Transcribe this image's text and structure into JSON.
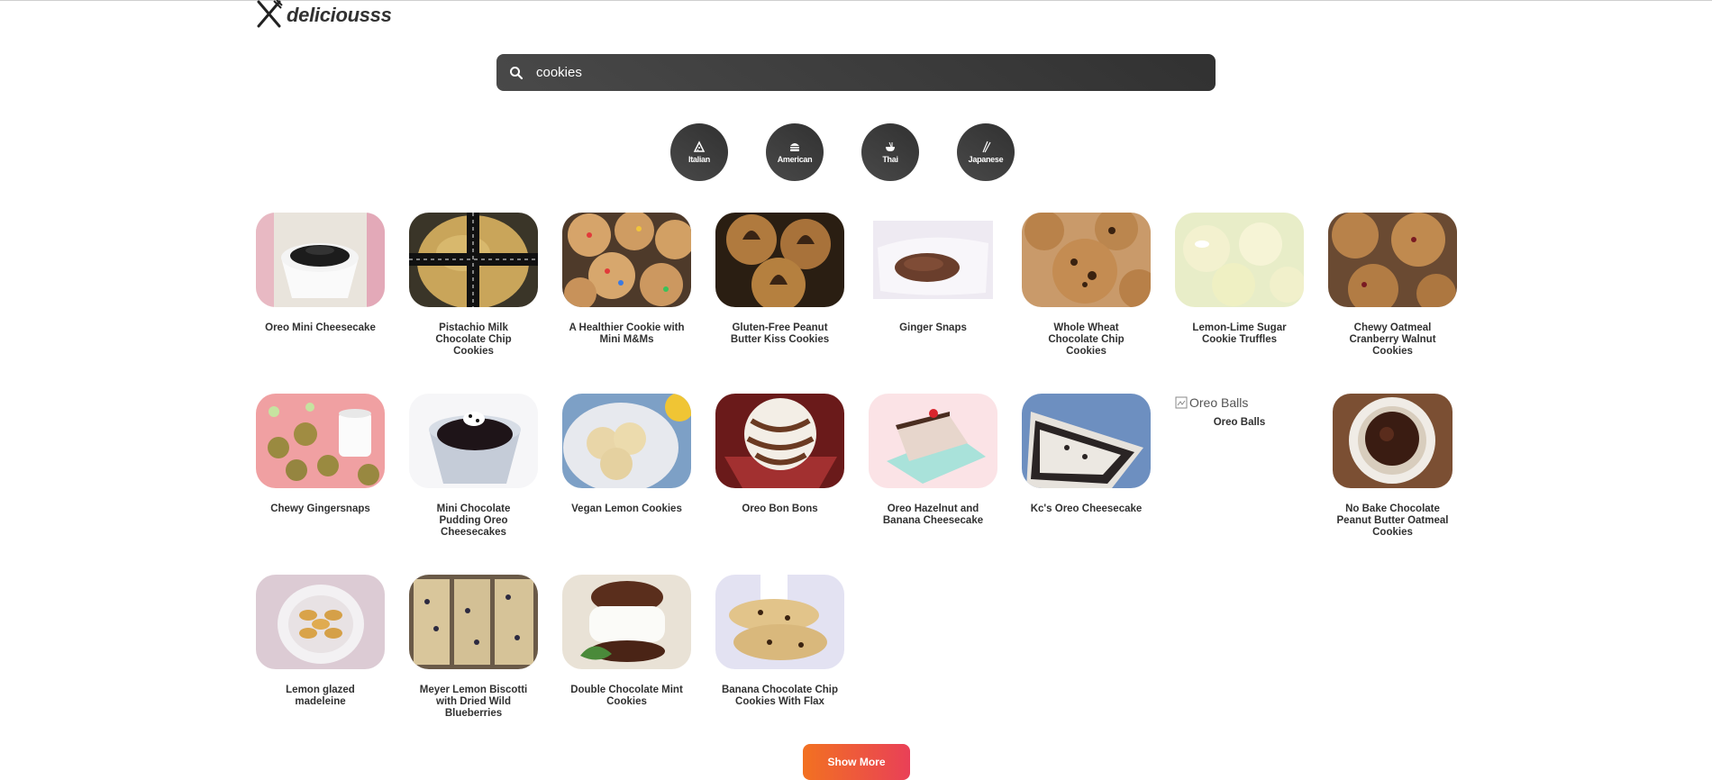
{
  "brand": {
    "name": "deliciousss",
    "icon": "fork-knife-icon"
  },
  "search": {
    "value": "cookies",
    "icon": "search-icon"
  },
  "cuisines": [
    {
      "label": "Italian",
      "icon": "pizza-icon"
    },
    {
      "label": "American",
      "icon": "hamburger-icon"
    },
    {
      "label": "Thai",
      "icon": "noodle-bowl-icon"
    },
    {
      "label": "Japanese",
      "icon": "chopsticks-icon"
    }
  ],
  "recipes": [
    {
      "title": "Oreo Mini Cheesecake"
    },
    {
      "title": "Pistachio Milk Chocolate Chip Cookies"
    },
    {
      "title": "A Healthier Cookie with Mini M&Ms"
    },
    {
      "title": "Gluten-Free Peanut Butter Kiss Cookies"
    },
    {
      "title": "Ginger Snaps"
    },
    {
      "title": "Whole Wheat Chocolate Chip Cookies"
    },
    {
      "title": "Lemon-Lime Sugar Cookie Truffles"
    },
    {
      "title": "Chewy Oatmeal Cranberry Walnut Cookies"
    },
    {
      "title": "Chewy Gingersnaps"
    },
    {
      "title": "Mini Chocolate Pudding Oreo Cheesecakes"
    },
    {
      "title": "Vegan Lemon Cookies"
    },
    {
      "title": "Oreo Bon Bons"
    },
    {
      "title": "Oreo Hazelnut and Banana Cheesecake"
    },
    {
      "title": "Kc's Oreo Cheesecake"
    },
    {
      "title": "Oreo Balls",
      "image_alt": "Oreo Balls"
    },
    {
      "title": "No Bake Chocolate Peanut Butter Oatmeal Cookies"
    },
    {
      "title": "Lemon glazed madeleine"
    },
    {
      "title": "Meyer Lemon Biscotti with Dried Wild Blueberries"
    },
    {
      "title": "Double Chocolate Mint Cookies"
    },
    {
      "title": "Banana Chocolate Chip Cookies With Flax"
    }
  ],
  "show_more": {
    "label": "Show More"
  },
  "colors": {
    "dark": "#313131",
    "gradient_start": "#f27121",
    "gradient_end": "#e94057"
  }
}
